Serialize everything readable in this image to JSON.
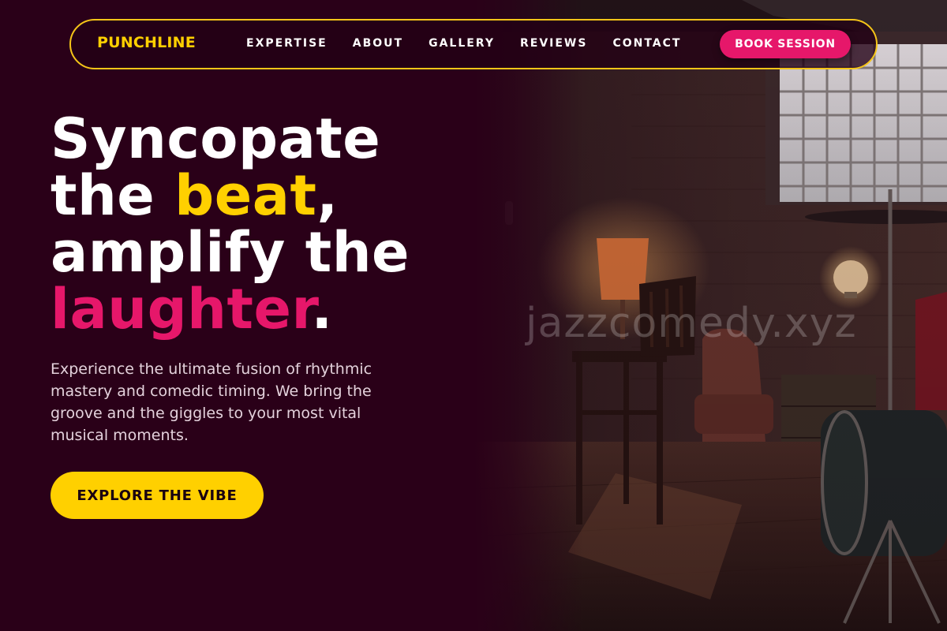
{
  "nav": {
    "brand": "PUNCHLINE",
    "links": [
      "EXPERTISE",
      "ABOUT",
      "GALLERY",
      "REVIEWS",
      "CONTACT"
    ],
    "cta": "BOOK SESSION"
  },
  "hero": {
    "line1": "Syncopate",
    "line2_pre": "the ",
    "line2_highlight": "beat",
    "line2_post": ",",
    "line3": "amplify the",
    "line4_highlight": "laughter",
    "line4_post": ".",
    "description": "Experience the ultimate fusion of rhythmic mastery and comedic timing. We bring the groove and the giggles to your most vital musical moments.",
    "cta": "EXPLORE THE VIBE"
  },
  "image": {
    "watermark": "jazzcomedy.xyz",
    "alt_icon": "jazz-club-stage-photo"
  },
  "colors": {
    "background": "#2a0018",
    "accent_yellow": "#ffd000",
    "accent_pink": "#e6176a",
    "nav_border": "#f5c518"
  }
}
